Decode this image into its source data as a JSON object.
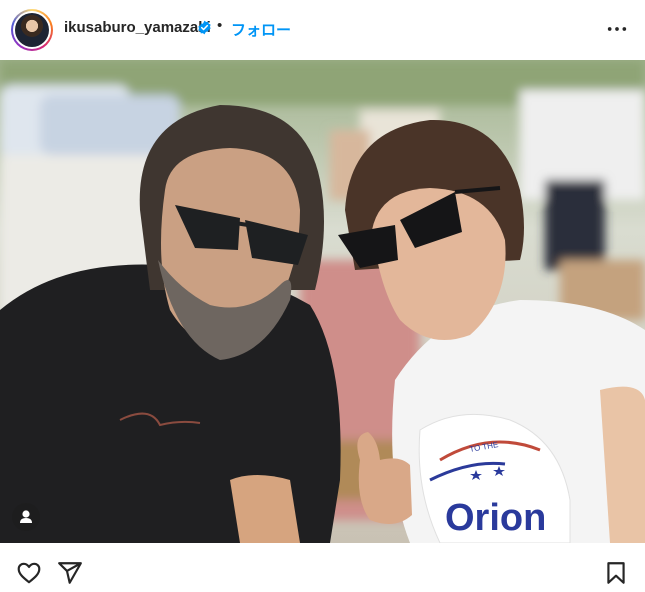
{
  "post_header": {
    "username": "ikusaburo_yamazaki",
    "follow_label": "フォロー",
    "separator": "•"
  },
  "icons": {
    "verified": "verified-badge-icon",
    "more": "more-options-icon",
    "tag": "user-tag-icon",
    "like": "heart-icon",
    "share": "share-icon",
    "save": "bookmark-icon"
  },
  "photo": {
    "shirt_print": [
      "Orion",
      "TO THE"
    ]
  },
  "colors": {
    "link": "#0095f6",
    "text": "#262626"
  }
}
